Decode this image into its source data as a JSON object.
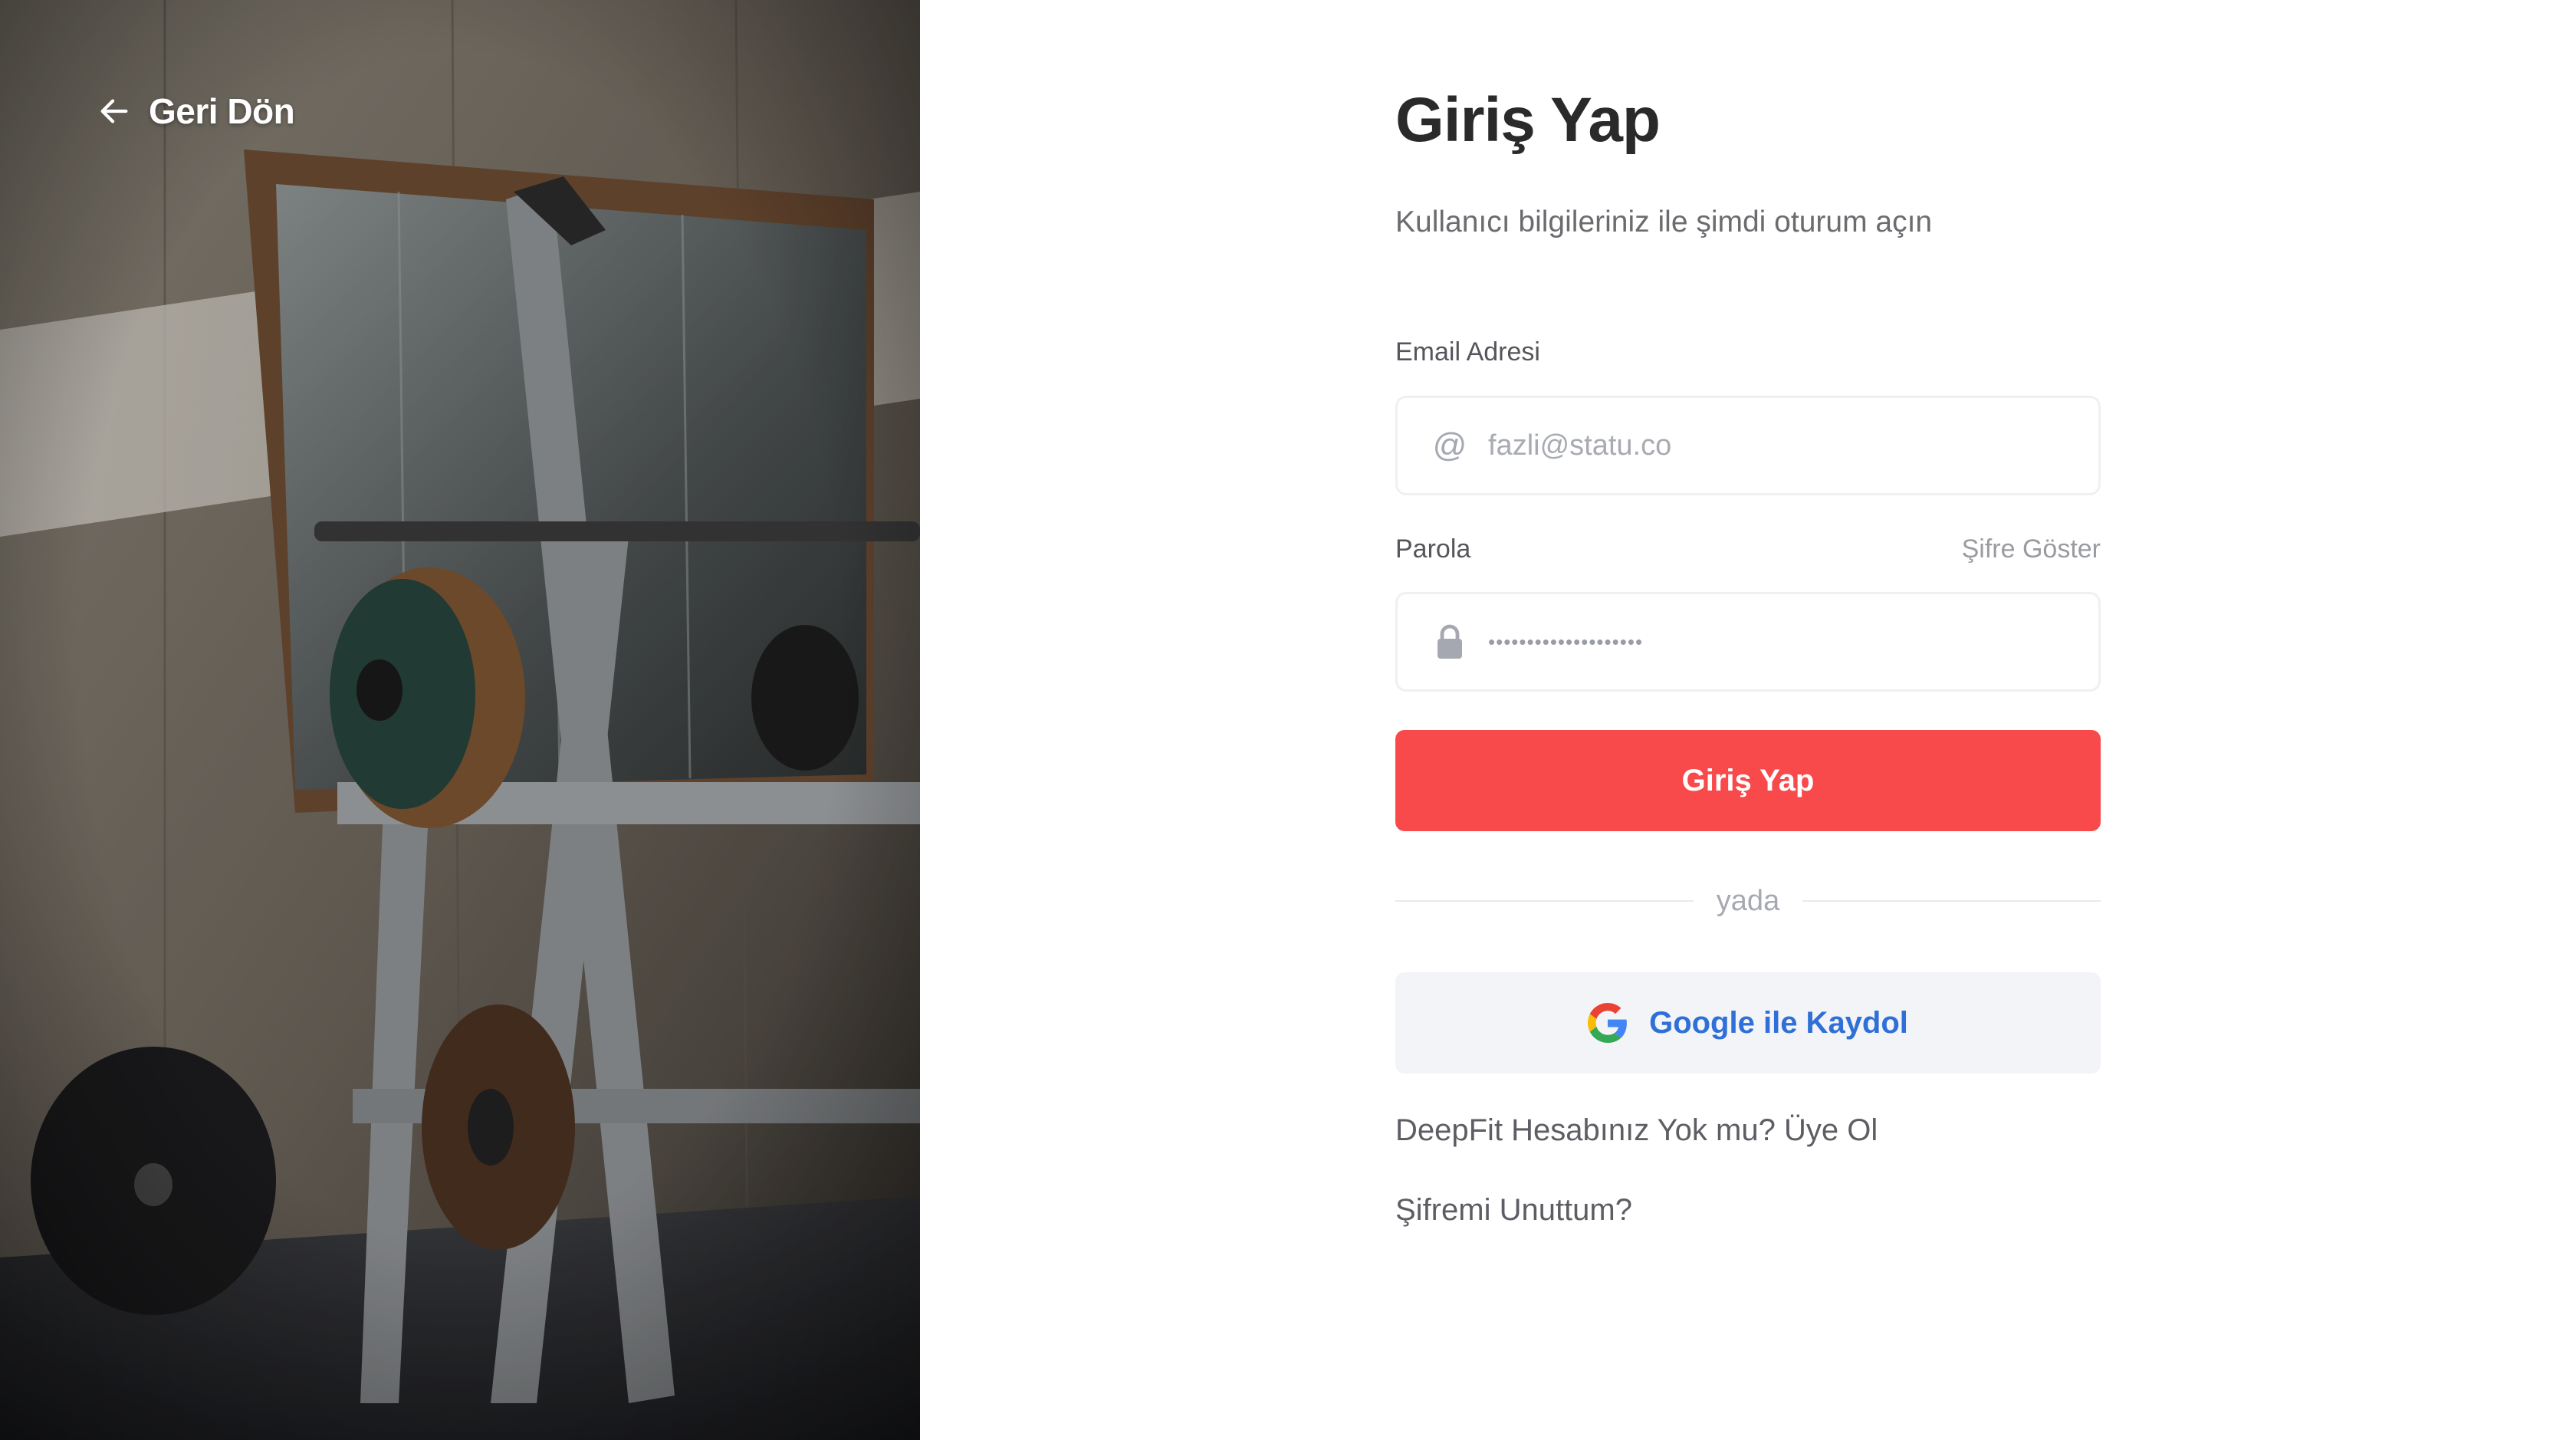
{
  "left_panel": {
    "back_label": "Geri Dön"
  },
  "form": {
    "title": "Giriş Yap",
    "subtitle": "Kullanıcı bilgileriniz ile şimdi oturum açın",
    "email": {
      "label": "Email Adresi",
      "placeholder": "fazli@statu.co",
      "icon": "at-icon"
    },
    "password": {
      "label": "Parola",
      "show_label": "Şifre Göster",
      "masked_value": "••••••••••••••••••••",
      "icon": "lock-icon"
    },
    "submit_label": "Giriş Yap",
    "divider_text": "yada",
    "google_label": "Google ile Kaydol",
    "signup_link": "DeepFit Hesabınız Yok mu? Üye Ol",
    "forgot_link": "Şifremi Unuttum?"
  },
  "colors": {
    "primary": "#f8494b",
    "google_text": "#2f6fd8",
    "title": "#2a2a2a",
    "muted": "#6b6b70"
  }
}
